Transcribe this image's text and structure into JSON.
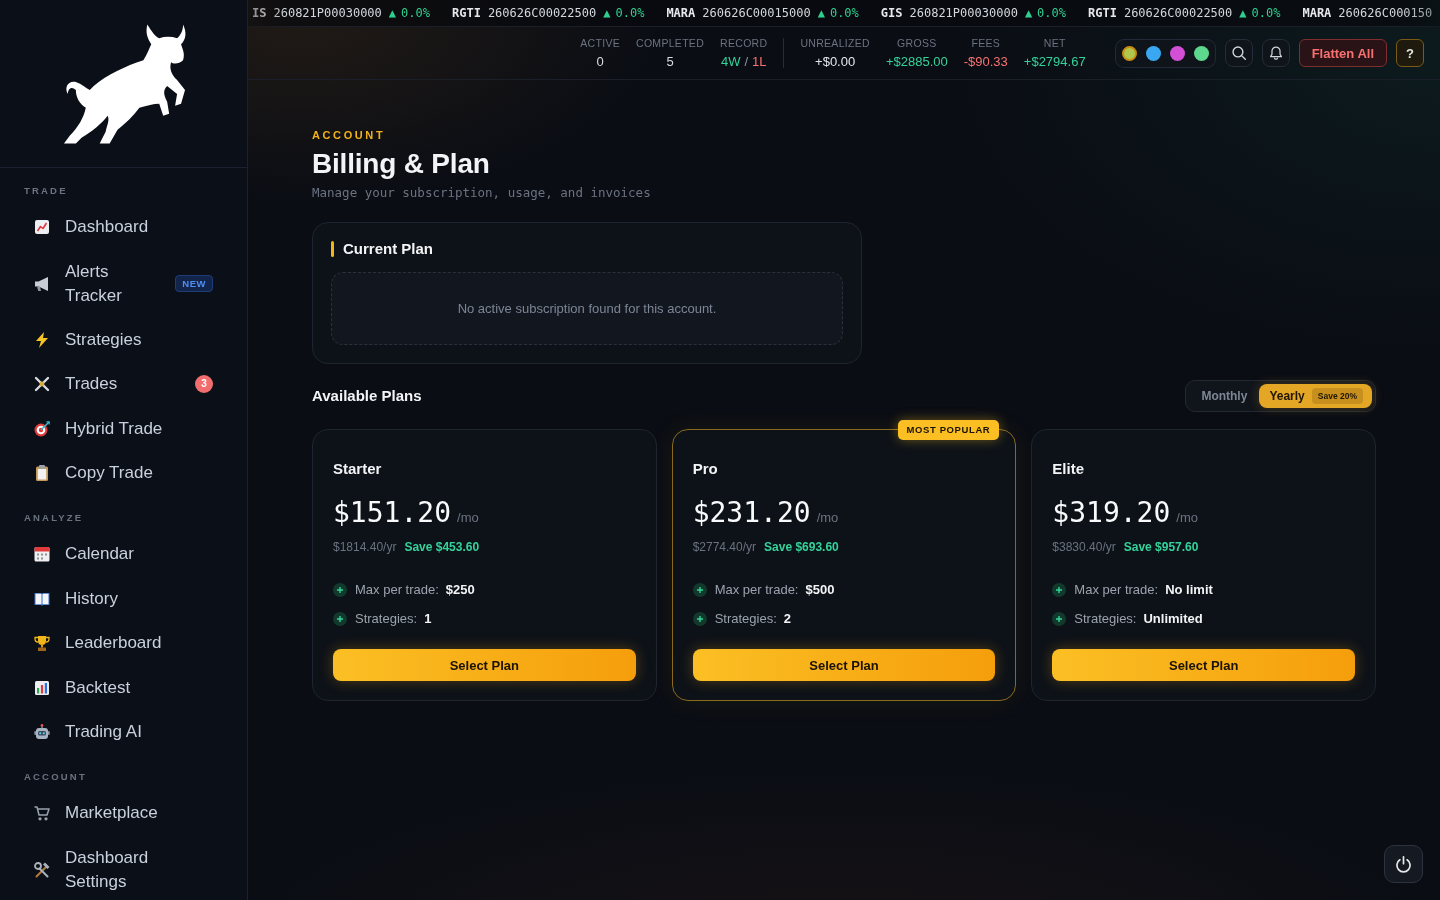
{
  "sidebar": {
    "sections": [
      {
        "title": "TRADE",
        "items": [
          {
            "label": "Dashboard",
            "selected": false
          },
          {
            "label": "Alerts Tracker",
            "selected": false,
            "badge": {
              "kind": "new",
              "text": "NEW"
            }
          },
          {
            "label": "Strategies",
            "selected": false
          },
          {
            "label": "Trades",
            "selected": false,
            "badge": {
              "kind": "count",
              "text": "3"
            }
          },
          {
            "label": "Hybrid Trade",
            "selected": false
          },
          {
            "label": "Copy Trade",
            "selected": false
          }
        ]
      },
      {
        "title": "ANALYZE",
        "items": [
          {
            "label": "Calendar",
            "selected": false
          },
          {
            "label": "History",
            "selected": false
          },
          {
            "label": "Leaderboard",
            "selected": false
          },
          {
            "label": "Backtest",
            "selected": false
          },
          {
            "label": "Trading AI",
            "selected": false
          }
        ]
      },
      {
        "title": "ACCOUNT",
        "items": [
          {
            "label": "Marketplace",
            "selected": false
          },
          {
            "label": "Dashboard Settings",
            "selected": false
          }
        ]
      }
    ]
  },
  "ticker": [
    {
      "symbol": "IS",
      "contract": "260821P00030000",
      "arrow": "▲",
      "change": "0.0%"
    },
    {
      "symbol": "RGTI",
      "contract": "260626C00022500",
      "arrow": "▲",
      "change": "0.0%"
    },
    {
      "symbol": "MARA",
      "contract": "260626C00015000",
      "arrow": "▲",
      "change": "0.0%"
    },
    {
      "symbol": "GIS",
      "contract": "260821P00030000",
      "arrow": "▲",
      "change": "0.0%"
    },
    {
      "symbol": "RGTI",
      "contract": "260626C00022500",
      "arrow": "▲",
      "change": "0.0%"
    },
    {
      "symbol": "MARA",
      "contract": "260626C000150"
    }
  ],
  "stats": {
    "groups": [
      {
        "items": [
          {
            "label": "ACTIVE",
            "kind": "single",
            "value": "0",
            "color": "#d7dce4"
          },
          {
            "label": "COMPLETED",
            "kind": "single",
            "value": "5",
            "color": "#d7dce4"
          },
          {
            "label": "RECORD",
            "kind": "record",
            "wins": "4W",
            "separator": "/",
            "losses": "1L"
          }
        ]
      },
      {
        "items": [
          {
            "label": "UNREALIZED",
            "kind": "single",
            "value": "+$0.00",
            "color": "#e5e7eb"
          },
          {
            "label": "GROSS",
            "kind": "single",
            "value": "+$2885.00",
            "color": "#34d399"
          },
          {
            "label": "FEES",
            "kind": "single",
            "value": "-$90.33",
            "color": "#f87171"
          },
          {
            "label": "NET",
            "kind": "single",
            "value": "+$2794.67",
            "color": "#34d399"
          }
        ]
      }
    ]
  },
  "themes": [
    {
      "color": "#b0c64c",
      "selected": true
    },
    {
      "color": "#3aa8f0",
      "selected": false
    },
    {
      "color": "#d24fd6",
      "selected": false
    },
    {
      "color": "#5dd68e",
      "selected": false
    }
  ],
  "actions": {
    "flatten": "Flatten All",
    "help": "?"
  },
  "page": {
    "eyebrow": "ACCOUNT",
    "title": "Billing & Plan",
    "subtitle": "Manage your subscription, usage, and invoices"
  },
  "current_plan": {
    "title": "Current Plan",
    "empty_message": "No active subscription found for this account."
  },
  "plans": {
    "title": "Available Plans",
    "billing_toggle": [
      {
        "label": "Monthly",
        "selected": false
      },
      {
        "label": "Yearly",
        "selected": true,
        "badge": "Save 20%"
      }
    ],
    "items": [
      {
        "name": "Starter",
        "featured": false,
        "price": "$151.20",
        "period": "/mo",
        "yearly": "$1814.40/yr",
        "savings": "Save $453.60",
        "features": [
          {
            "label": "Max per trade:",
            "value": "$250"
          },
          {
            "label": "Strategies:",
            "value": "1"
          }
        ],
        "button": "Select Plan"
      },
      {
        "name": "Pro",
        "featured": true,
        "badge": "MOST POPULAR",
        "price": "$231.20",
        "period": "/mo",
        "yearly": "$2774.40/yr",
        "savings": "Save $693.60",
        "features": [
          {
            "label": "Max per trade:",
            "value": "$500"
          },
          {
            "label": "Strategies:",
            "value": "2"
          }
        ],
        "button": "Select Plan"
      },
      {
        "name": "Elite",
        "featured": false,
        "price": "$319.20",
        "period": "/mo",
        "yearly": "$3830.40/yr",
        "savings": "Save $957.60",
        "features": [
          {
            "label": "Max per trade:",
            "value": "No limit"
          },
          {
            "label": "Strategies:",
            "value": "Unlimited"
          }
        ],
        "button": "Select Plan"
      }
    ]
  }
}
